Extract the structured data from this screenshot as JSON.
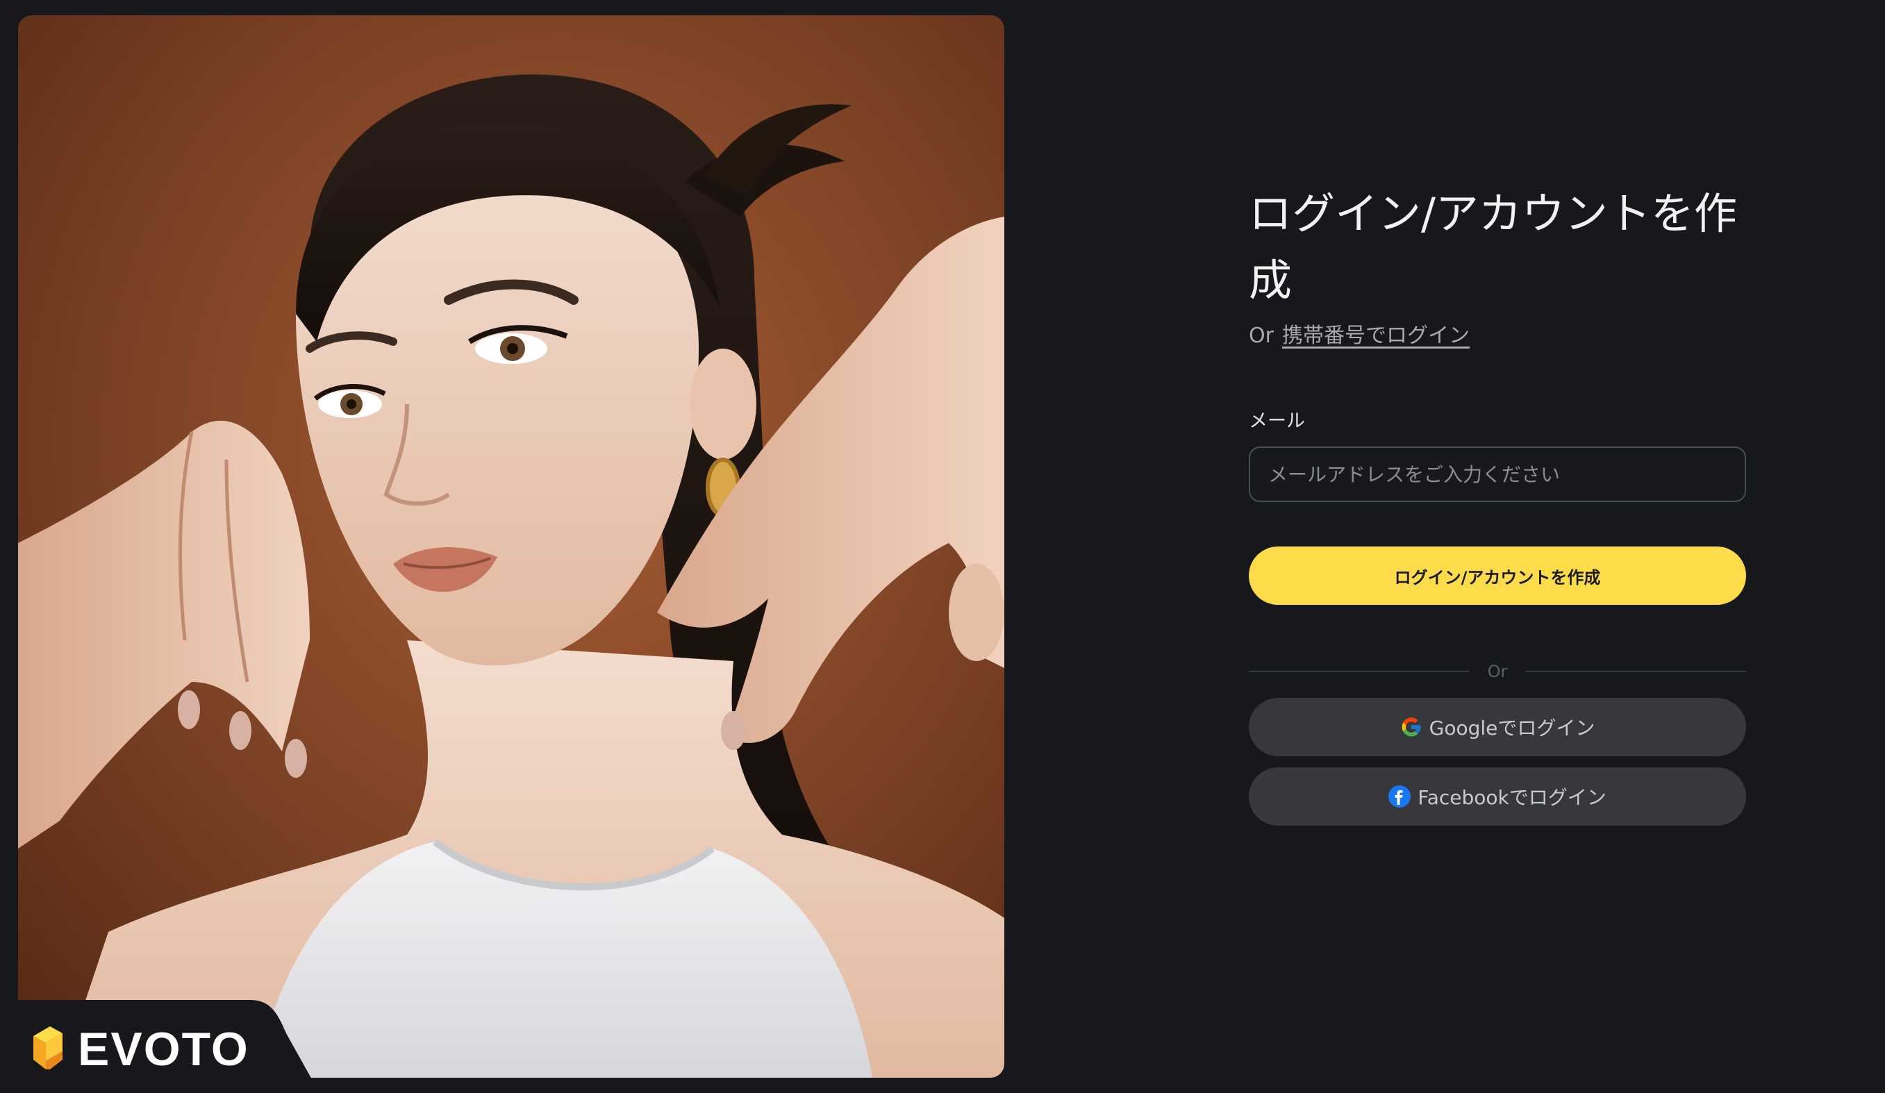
{
  "brand": {
    "name": "EVOTO",
    "accent_color": "#fddc4b"
  },
  "hero": {
    "image_alt": "Portrait of a model with hands framing her face on a brown background"
  },
  "login": {
    "title": "ログイン/アカウントを作成",
    "alt_prefix": "Or",
    "alt_link": "携帯番号でログイン",
    "email_label": "メール",
    "email_placeholder": "メールアドレスをご入力ください",
    "email_value": "",
    "submit_label": "ログイン/アカウントを作成",
    "divider_text": "Or",
    "google_label": "Googleでログイン",
    "facebook_label": "Facebookでログイン"
  },
  "icons": {
    "google": "google-icon",
    "facebook": "facebook-icon",
    "brand": "evoto-logo-icon"
  },
  "colors": {
    "background": "#16181b",
    "primary_button": "#fddc4b",
    "social_button": "#36383c"
  }
}
